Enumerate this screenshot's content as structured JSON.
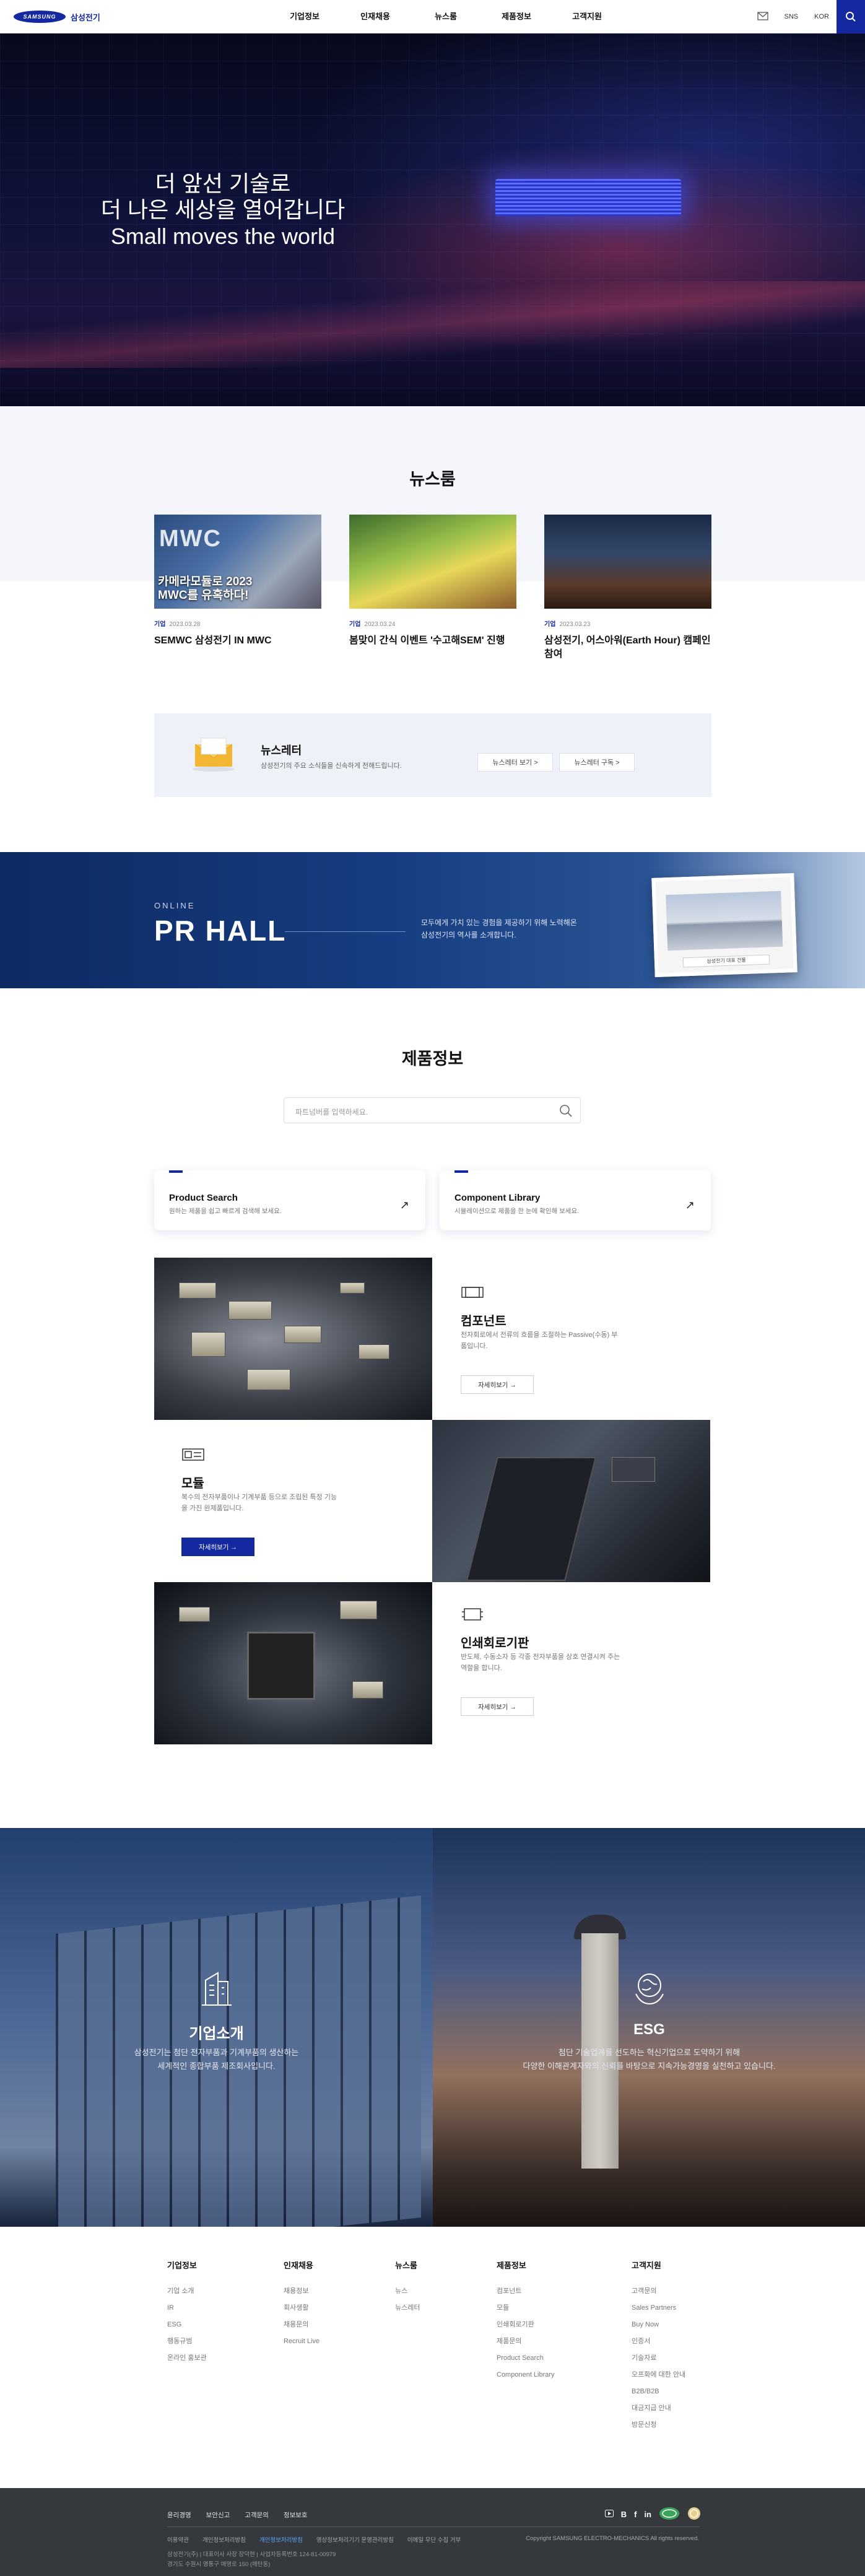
{
  "header": {
    "logo_text": "SAMSUNG",
    "logo_kr": "삼성전기",
    "nav": [
      "기업정보",
      "인재채용",
      "뉴스룸",
      "제품정보",
      "고객지원"
    ],
    "sns": "SNS",
    "lang": "KOR"
  },
  "hero": {
    "line1": "더 앞선 기술로",
    "line2": "더 나은 세상을 열어갑니다",
    "line3": "Small moves the world"
  },
  "newsroom": {
    "title": "뉴스룸",
    "cards": [
      {
        "category": "기업",
        "date": "2023.03.28",
        "title": "SEMWC 삼성전기 IN MWC",
        "image_text": "카메라모듈로 2023 MWC를 유혹하다!",
        "image_logo": "MWC"
      },
      {
        "category": "기업",
        "date": "2023.03.24",
        "title": "봄맞이 간식 이벤트 '수고해SEM' 진행"
      },
      {
        "category": "기업",
        "date": "2023.03.23",
        "title": "삼성전기, 어스아워(Earth Hour) 캠페인 참여"
      }
    ],
    "newsletter": {
      "title": "뉴스레터",
      "desc": "삼성전기의 주요 소식들을 신속하게 전해드립니다.",
      "btn_view": "뉴스레터 보기 >",
      "btn_sub": "뉴스레터 구독 >"
    }
  },
  "prhall": {
    "online": "ONLINE",
    "title": "PR HALL",
    "desc1": "모두에게 가치 있는 경험을 제공하기 위해 노력해온",
    "desc2": "삼성전기의 역사를 소개합니다.",
    "caption": "삼성전기 대표 건물"
  },
  "products": {
    "title": "제품정보",
    "search_placeholder": "파트넘버를 입력하세요.",
    "cards": [
      {
        "title": "Product Search",
        "desc": "원하는 제품을 쉽고 빠르게 검색해 보세요."
      },
      {
        "title": "Component Library",
        "desc": "시뮬레이션으로 제품을 한 눈에 확인해 보세요."
      }
    ],
    "items": [
      {
        "title": "컴포넌트",
        "desc": "전자회로에서 전류의 흐름을 조절하는 Passive(수동) 부품입니다.",
        "btn": "자세히보기 →"
      },
      {
        "title": "모듈",
        "desc": "복수의 전자부품이나 기계부품 등으로 조립된 특정 기능을 가진 완제품입니다.",
        "btn": "자세히보기 →"
      },
      {
        "title": "인쇄회로기판",
        "desc": "반도체, 수동소자 등 각종 전자부품을 상호 연결시켜 주는 역할을 합니다.",
        "btn": "자세히보기 →"
      }
    ]
  },
  "company": {
    "title": "기업소개",
    "desc1": "삼성전기는 첨단 전자부품과 기계부품의 생산하는",
    "desc2": "세계적인 종합부품 제조회사입니다."
  },
  "esg": {
    "title": "ESG",
    "desc1": "첨단 기술업계를 선도하는 혁신기업으로 도약하기 위해",
    "desc2": "다양한 이해관계자와의 신뢰를 바탕으로 지속가능경영을 실천하고 있습니다."
  },
  "sitemap": [
    {
      "head": "기업정보",
      "items": [
        "기업 소개",
        "IR",
        "ESG",
        "행동규범",
        "온라인 홍보관"
      ]
    },
    {
      "head": "인재채용",
      "items": [
        "채용정보",
        "회사생활",
        "채용문의",
        "Recruit Live"
      ]
    },
    {
      "head": "뉴스룸",
      "items": [
        "뉴스",
        "뉴스레터"
      ]
    },
    {
      "head": "제품정보",
      "items": [
        "컴포넌트",
        "모듈",
        "인쇄회로기판",
        "제품문의",
        "Product Search",
        "Component Library"
      ]
    },
    {
      "head": "고객지원",
      "items": [
        "고객문의",
        "Sales Partners",
        "Buy Now",
        "인증서",
        "기술자료",
        "오프화에 대한 안내",
        "B2B/B2B",
        "대금지급 안내",
        "방문신청"
      ]
    }
  ],
  "footer": {
    "links": [
      "윤리경영",
      "보안신고",
      "고객문의",
      "정보보호"
    ],
    "links2": [
      "이용약관",
      "개인정보처리방침",
      "개인정보처리방침",
      "영상정보처리기기 운영관리방침",
      "이메일 무단 수집 거부"
    ],
    "copyright": "Copyright  SAMSUNG ELECTRO-MECHANICS All rights reserved.",
    "addr1": "삼성전기(주)  |  대표이사 사장 장덕현  |  사업자등록번호 124-81-00979",
    "addr2": "경기도 수원시 영통구 매영로 150 (매탄동)",
    "social": [
      "B",
      "f",
      "in"
    ]
  }
}
